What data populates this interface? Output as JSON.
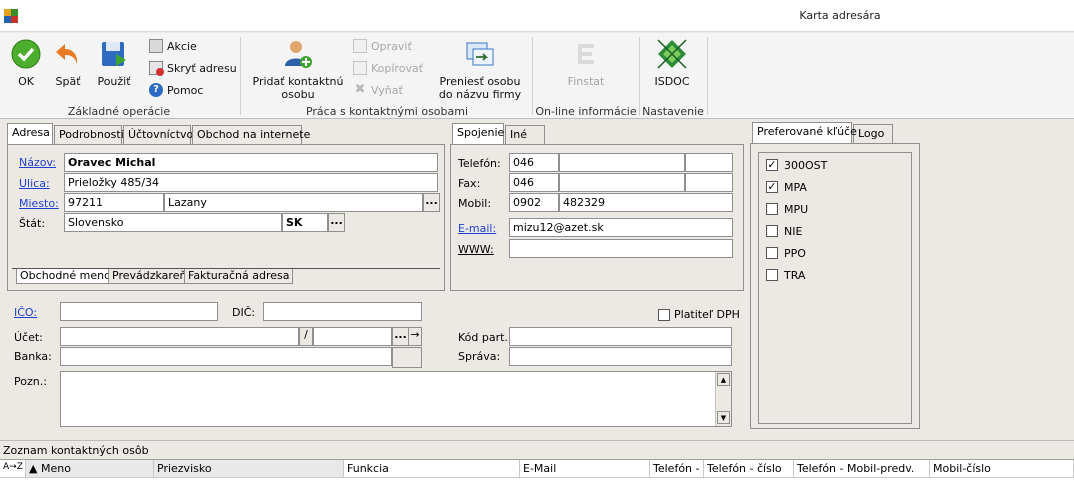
{
  "window": {
    "title": "Karta adresára",
    "app_icon": "app-icon"
  },
  "ribbon": {
    "ok": "OK",
    "back": "Späť",
    "use": "Použiť",
    "actions": "Akcie",
    "hide_address": "Skryť adresu",
    "help": "Pomoc",
    "add_contact": "Pridať kontaktnú osobu",
    "edit": "Opraviť",
    "copy": "Kopírovať",
    "cut": "Vyňať",
    "transfer": "Preniesť osobu do názvu firmy",
    "finstat": "Finstat",
    "isdoc": "ISDOC",
    "groups": {
      "basic": "Základné operácie",
      "contacts": "Práca s kontaktnými osobami",
      "online": "On-line informácie",
      "settings": "Nastavenie"
    }
  },
  "address_tabs": [
    "Adresa",
    "Podrobnosti",
    "Účtovníctvo",
    "Obchod na internete"
  ],
  "address": {
    "name_label": "Názov:",
    "name": "Oravec Michal",
    "street_label": "Ulica:",
    "street": "Prieložky 485/34",
    "city_label": "Miesto:",
    "zip": "97211",
    "city": "Lazany",
    "country_label": "Štát:",
    "country": "Slovensko",
    "country_code": "SK",
    "dots": "..."
  },
  "name_tabs": [
    "Obchodné meno",
    "Prevádzkareň",
    "Fakturačná adresa"
  ],
  "contact_tabs": [
    "Spojenie",
    "Iné"
  ],
  "contact": {
    "phone_label": "Telefón:",
    "phone_prefix": "046",
    "fax_label": "Fax:",
    "fax_prefix": "046",
    "mobile_label": "Mobil:",
    "mobile_prefix": "0902",
    "mobile_number": "482329",
    "email_label": "E-mail:",
    "email": "mizu12@azet.sk",
    "www_label": "WWW:"
  },
  "keys_tabs": [
    "Preferované kľúče",
    "Logo"
  ],
  "keys": [
    {
      "label": "300OST",
      "checked": true
    },
    {
      "label": "MPA",
      "checked": true
    },
    {
      "label": "MPU",
      "checked": false
    },
    {
      "label": "NIE",
      "checked": false
    },
    {
      "label": "PPO",
      "checked": false
    },
    {
      "label": "TRA",
      "checked": false
    }
  ],
  "details": {
    "ico_label": "IČO:",
    "dic_label": "DIČ:",
    "vat_payer_label": "Platiteľ DPH",
    "account_label": "Účet:",
    "slash": "/",
    "dots": "...",
    "arrow": "→",
    "bank_label": "Banka:",
    "partner_code_label": "Kód part.:",
    "admin_label": "Správa:",
    "note_label": "Pozn.:"
  },
  "contacts": {
    "title": "Zoznam kontaktných osôb",
    "sort_icon": "A→Z",
    "columns": [
      "Meno",
      "Priezvisko",
      "Funkcia",
      "E-Mail",
      "Telefón - p",
      "Telefón - číslo",
      "Telefón - Mobil-predv.",
      "Mobil-číslo"
    ]
  }
}
